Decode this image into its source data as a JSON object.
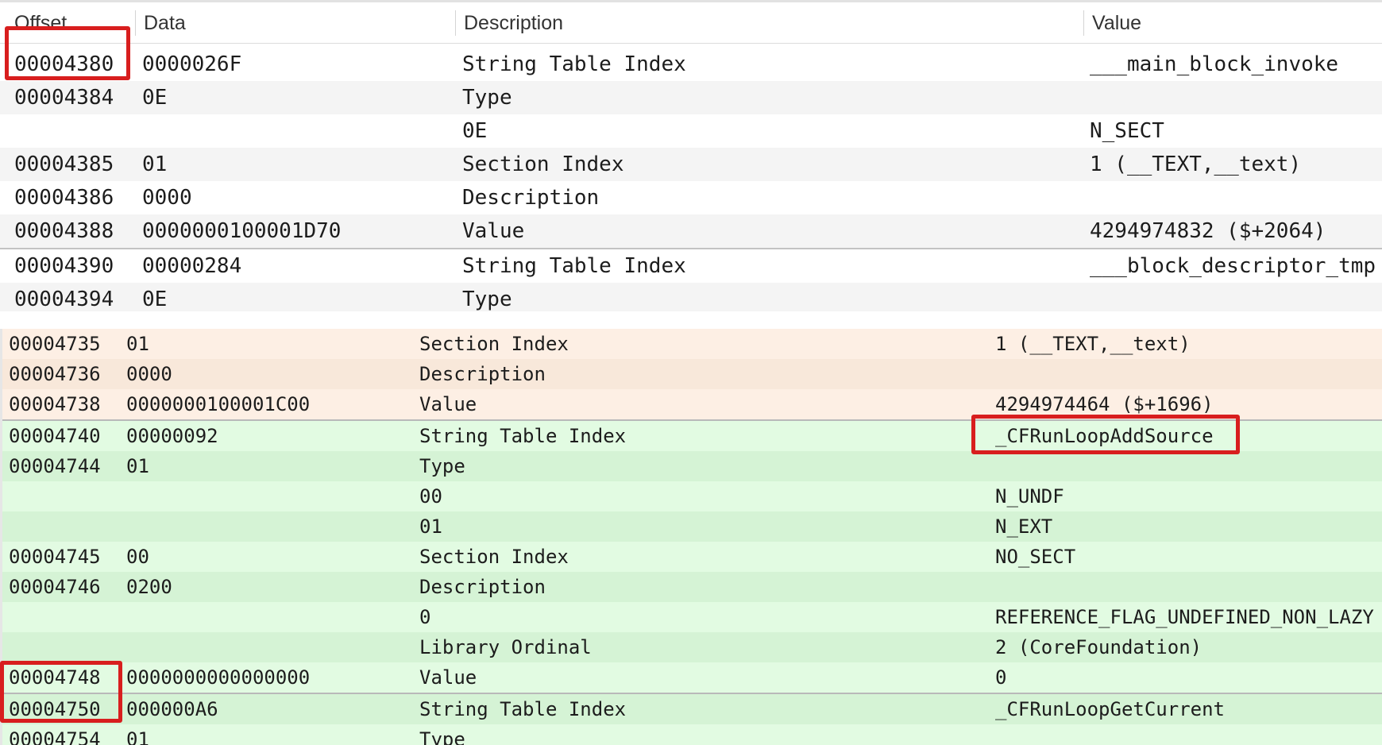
{
  "header": {
    "offset": "Offset",
    "data": "Data",
    "description": "Description",
    "value": "Value"
  },
  "top_rows": [
    {
      "offset": "00004380",
      "data": "0000026F",
      "description": "String Table Index",
      "value": "___main_block_invoke"
    },
    {
      "offset": "00004384",
      "data": "0E",
      "description": "Type",
      "value": ""
    },
    {
      "offset": "",
      "data": "",
      "description": "0E",
      "value": "N_SECT"
    },
    {
      "offset": "00004385",
      "data": "01",
      "description": "Section Index",
      "value": "1 (__TEXT,__text)"
    },
    {
      "offset": "00004386",
      "data": "0000",
      "description": "Description",
      "value": ""
    },
    {
      "offset": "00004388",
      "data": "0000000100001D70",
      "description": "Value",
      "value": "4294974832 ($+2064)"
    },
    {
      "offset": "00004390",
      "data": "00000284",
      "description": "String Table Index",
      "value": "___block_descriptor_tmp"
    },
    {
      "offset": "00004394",
      "data": "0E",
      "description": "Type",
      "value": ""
    }
  ],
  "bottom_rows": [
    {
      "offset": "00004735",
      "data": "01",
      "description": "Section Index",
      "value": "1 (__TEXT,__text)"
    },
    {
      "offset": "00004736",
      "data": "0000",
      "description": "Description",
      "value": ""
    },
    {
      "offset": "00004738",
      "data": "0000000100001C00",
      "description": "Value",
      "value": "4294974464 ($+1696)"
    },
    {
      "offset": "00004740",
      "data": "00000092",
      "description": "String Table Index",
      "value": "_CFRunLoopAddSource"
    },
    {
      "offset": "00004744",
      "data": "01",
      "description": "Type",
      "value": ""
    },
    {
      "offset": "",
      "data": "",
      "description": "00",
      "value": "N_UNDF"
    },
    {
      "offset": "",
      "data": "",
      "description": "01",
      "value": "N_EXT"
    },
    {
      "offset": "00004745",
      "data": "00",
      "description": "Section Index",
      "value": "NO_SECT"
    },
    {
      "offset": "00004746",
      "data": "0200",
      "description": "Description",
      "value": ""
    },
    {
      "offset": "",
      "data": "",
      "description": "0",
      "value": "REFERENCE_FLAG_UNDEFINED_NON_LAZY"
    },
    {
      "offset": "",
      "data": "",
      "description": "Library Ordinal",
      "value": "2 (CoreFoundation)"
    },
    {
      "offset": "00004748",
      "data": "0000000000000000",
      "description": "Value",
      "value": "0"
    },
    {
      "offset": "00004750",
      "data": "000000A6",
      "description": "String Table Index",
      "value": "_CFRunLoopGetCurrent"
    },
    {
      "offset": "00004754",
      "data": "01",
      "description": "Type",
      "value": ""
    }
  ],
  "colors": {
    "highlight": "#d81e1e",
    "orange_row": "#fdefe4",
    "green_row": "#dffbdf"
  }
}
